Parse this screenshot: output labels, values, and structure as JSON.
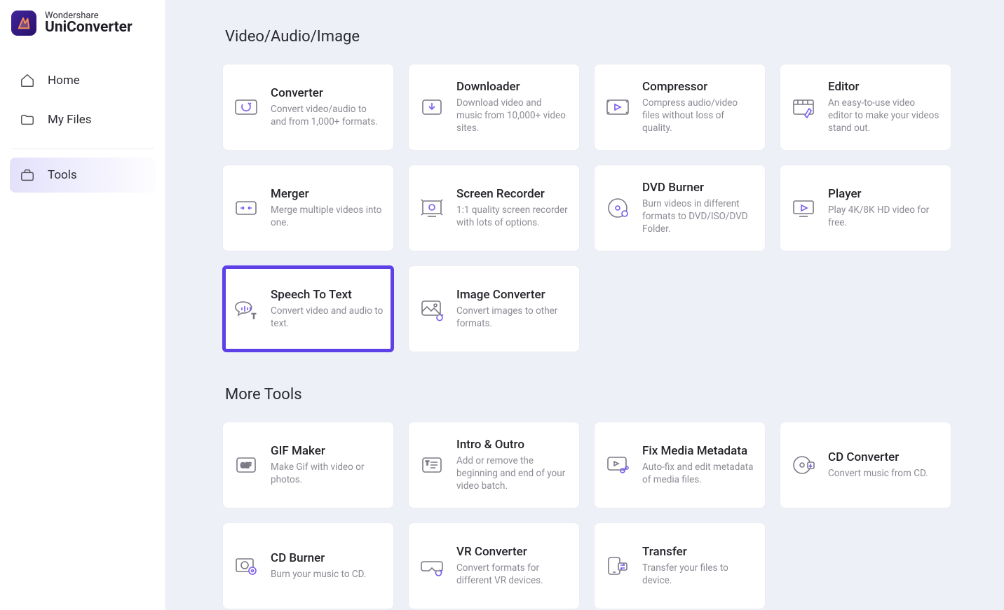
{
  "brand": {
    "line1": "Wondershare",
    "line2": "UniConverter"
  },
  "nav": {
    "home": {
      "label": "Home"
    },
    "files": {
      "label": "My Files"
    },
    "tools": {
      "label": "Tools"
    }
  },
  "sections": {
    "media": {
      "title": "Video/Audio/Image"
    },
    "more": {
      "title": "More Tools"
    }
  },
  "tools": {
    "converter": {
      "title": "Converter",
      "desc": "Convert video/audio to and from 1,000+ formats."
    },
    "downloader": {
      "title": "Downloader",
      "desc": "Download video and music from 10,000+ video sites."
    },
    "compressor": {
      "title": "Compressor",
      "desc": "Compress audio/video files without loss of quality."
    },
    "editor": {
      "title": "Editor",
      "desc": "An easy-to-use video editor to make your videos stand out."
    },
    "merger": {
      "title": "Merger",
      "desc": "Merge multiple videos into one."
    },
    "recorder": {
      "title": "Screen Recorder",
      "desc": "1:1 quality screen recorder with lots of options."
    },
    "dvdburner": {
      "title": "DVD Burner",
      "desc": "Burn videos in different formats to DVD/ISO/DVD Folder."
    },
    "player": {
      "title": "Player",
      "desc": "Play 4K/8K HD video for free."
    },
    "stt": {
      "title": "Speech To Text",
      "desc": "Convert video and audio to text."
    },
    "imgconv": {
      "title": "Image Converter",
      "desc": "Convert images to other formats."
    },
    "gifmaker": {
      "title": "GIF Maker",
      "desc": "Make Gif with video or photos."
    },
    "introoutro": {
      "title": "Intro & Outro",
      "desc": "Add or remove the beginning and end of your video batch."
    },
    "metadata": {
      "title": "Fix Media Metadata",
      "desc": "Auto-fix and edit metadata of media files."
    },
    "cdconv": {
      "title": "CD Converter",
      "desc": "Convert music from CD."
    },
    "cdburner": {
      "title": "CD Burner",
      "desc": "Burn your music to CD."
    },
    "vr": {
      "title": "VR Converter",
      "desc": "Convert formats for different VR devices."
    },
    "transfer": {
      "title": "Transfer",
      "desc": "Transfer your files to device."
    }
  },
  "palette": {
    "accent": "#5e40e7",
    "iconStroke": "#7a7a86",
    "iconAccent": "#7a5cf0"
  }
}
